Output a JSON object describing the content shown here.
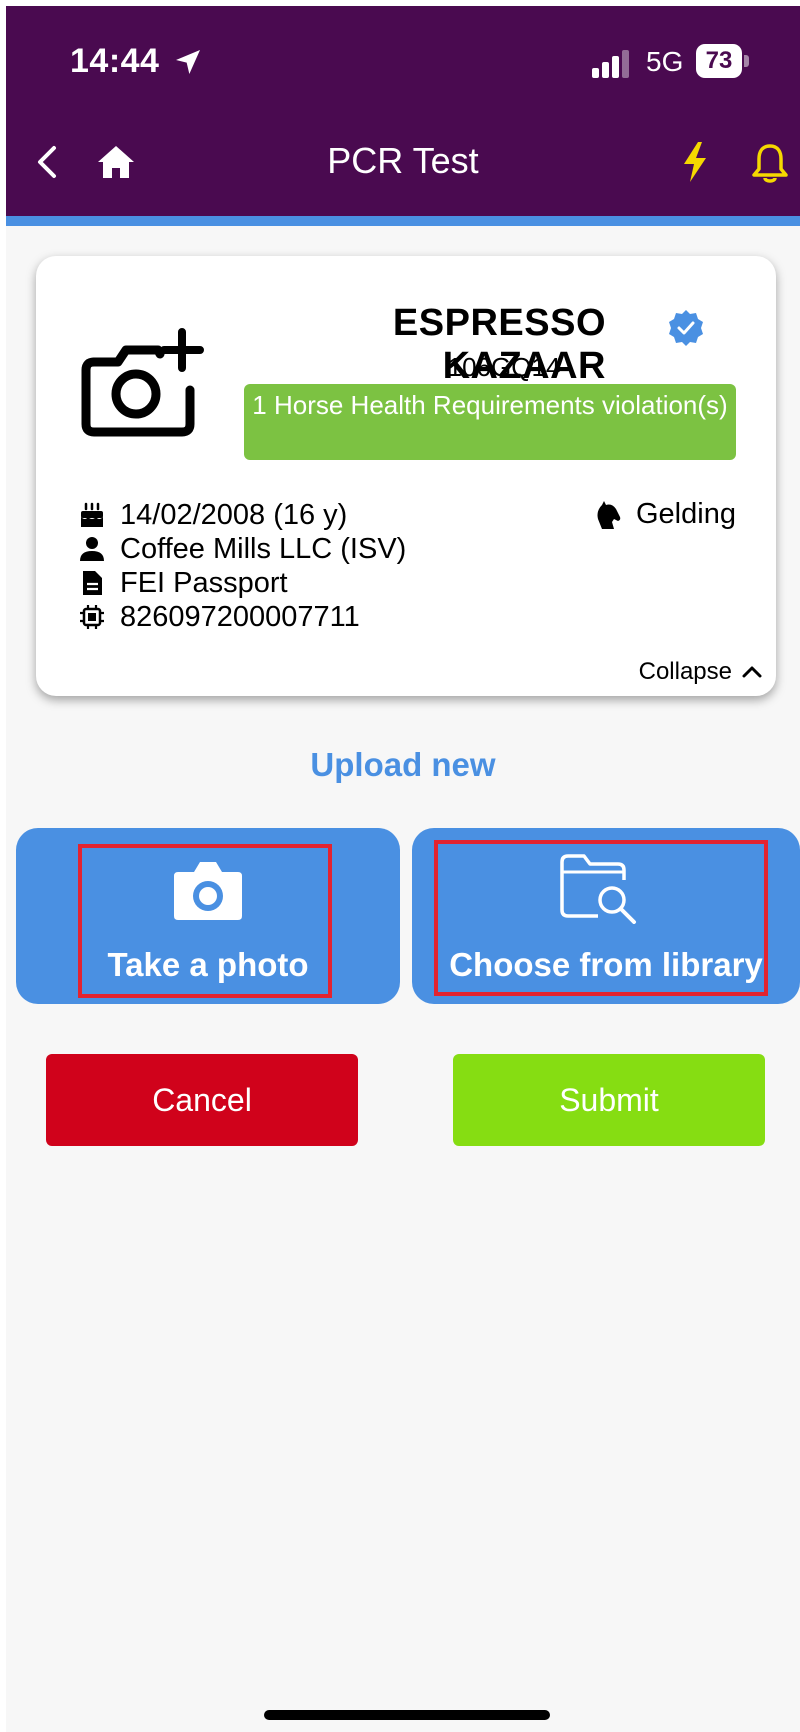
{
  "status_bar": {
    "time": "14:44",
    "network": "5G",
    "battery": "73"
  },
  "nav": {
    "title": "PCR Test",
    "icons": [
      "back-chevron-icon",
      "home-icon",
      "flash-icon",
      "bell-icon"
    ],
    "colors": {
      "background": "#4a0a50",
      "accent_strip": "#4a90e2",
      "icon_yellow": "#f5d800"
    }
  },
  "horse_card": {
    "name": "ESPRESSO KAZAAR",
    "id": "106GQ14",
    "violation": "1 Horse Health Requirements violation(s)",
    "birth": "14/02/2008 (16 y)",
    "owner": "Coffee Mills LLC (ISV)",
    "document": "FEI Passport",
    "chip": "826097200007711",
    "sex": "Gelding",
    "collapse_label": "Collapse",
    "colors": {
      "violation_bg": "#7cc242",
      "verified": "#4a90e2"
    }
  },
  "upload": {
    "title": "Upload new",
    "take_photo_label": "Take a photo",
    "library_label": "Choose from library"
  },
  "actions": {
    "cancel_label": "Cancel",
    "submit_label": "Submit",
    "colors": {
      "cancel": "#d0021b",
      "submit": "#86dd12"
    }
  }
}
